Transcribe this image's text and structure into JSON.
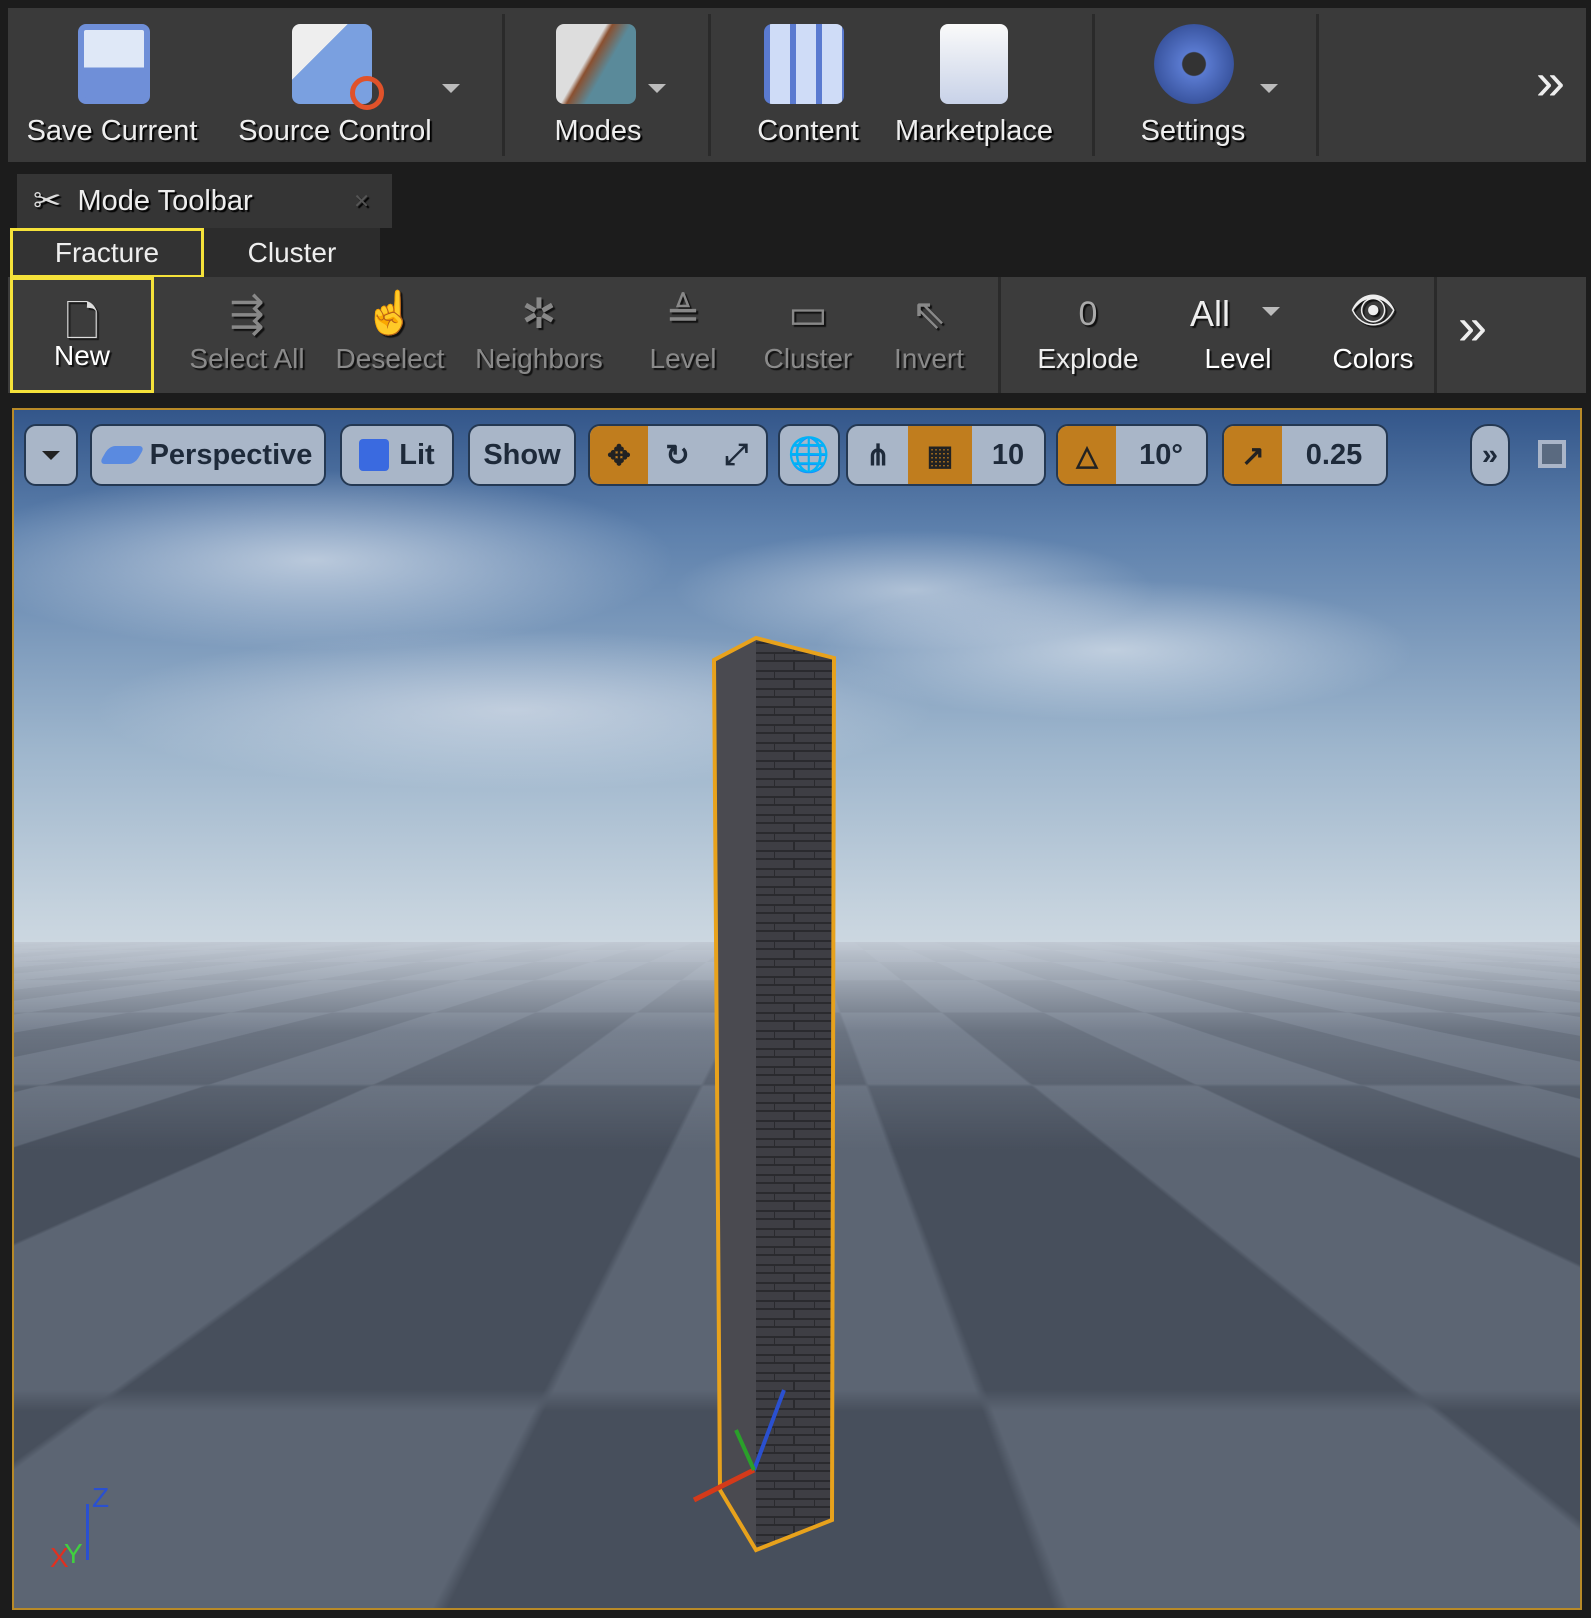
{
  "main_toolbar": {
    "items": [
      {
        "label": "Save Current",
        "icon": "save-icon"
      },
      {
        "label": "Source Control",
        "icon": "source-control-icon"
      },
      {
        "label": "Modes",
        "icon": "modes-icon"
      },
      {
        "label": "Content",
        "icon": "content-icon"
      },
      {
        "label": "Marketplace",
        "icon": "marketplace-icon"
      },
      {
        "label": "Settings",
        "icon": "settings-icon"
      }
    ],
    "overflow": "»"
  },
  "mode_toolbar": {
    "title": "Mode Toolbar",
    "tabs": [
      {
        "label": "Fracture",
        "active": true
      },
      {
        "label": "Cluster",
        "active": false
      }
    ],
    "tools": [
      {
        "label": "New",
        "enabled": true
      },
      {
        "label": "Select All"
      },
      {
        "label": "Deselect"
      },
      {
        "label": "Neighbors"
      },
      {
        "label": "Level"
      },
      {
        "label": "Cluster"
      },
      {
        "label": "Invert"
      }
    ],
    "explode": {
      "value": "0",
      "label": "Explode"
    },
    "level": {
      "value": "All",
      "label": "Level"
    },
    "colors": {
      "label": "Colors"
    },
    "overflow": "»"
  },
  "viewport": {
    "view_mode": "Perspective",
    "lighting": "Lit",
    "show": "Show",
    "grid_snap": "10",
    "rotation_snap": "10°",
    "scale_snap": "0.25",
    "overflow": "»",
    "axes": {
      "x": "X",
      "y": "Y",
      "z": "Z"
    }
  },
  "colors": {
    "highlight": "#f5e23a",
    "selection": "#e8a21c",
    "snap_active": "#c07d1e"
  }
}
